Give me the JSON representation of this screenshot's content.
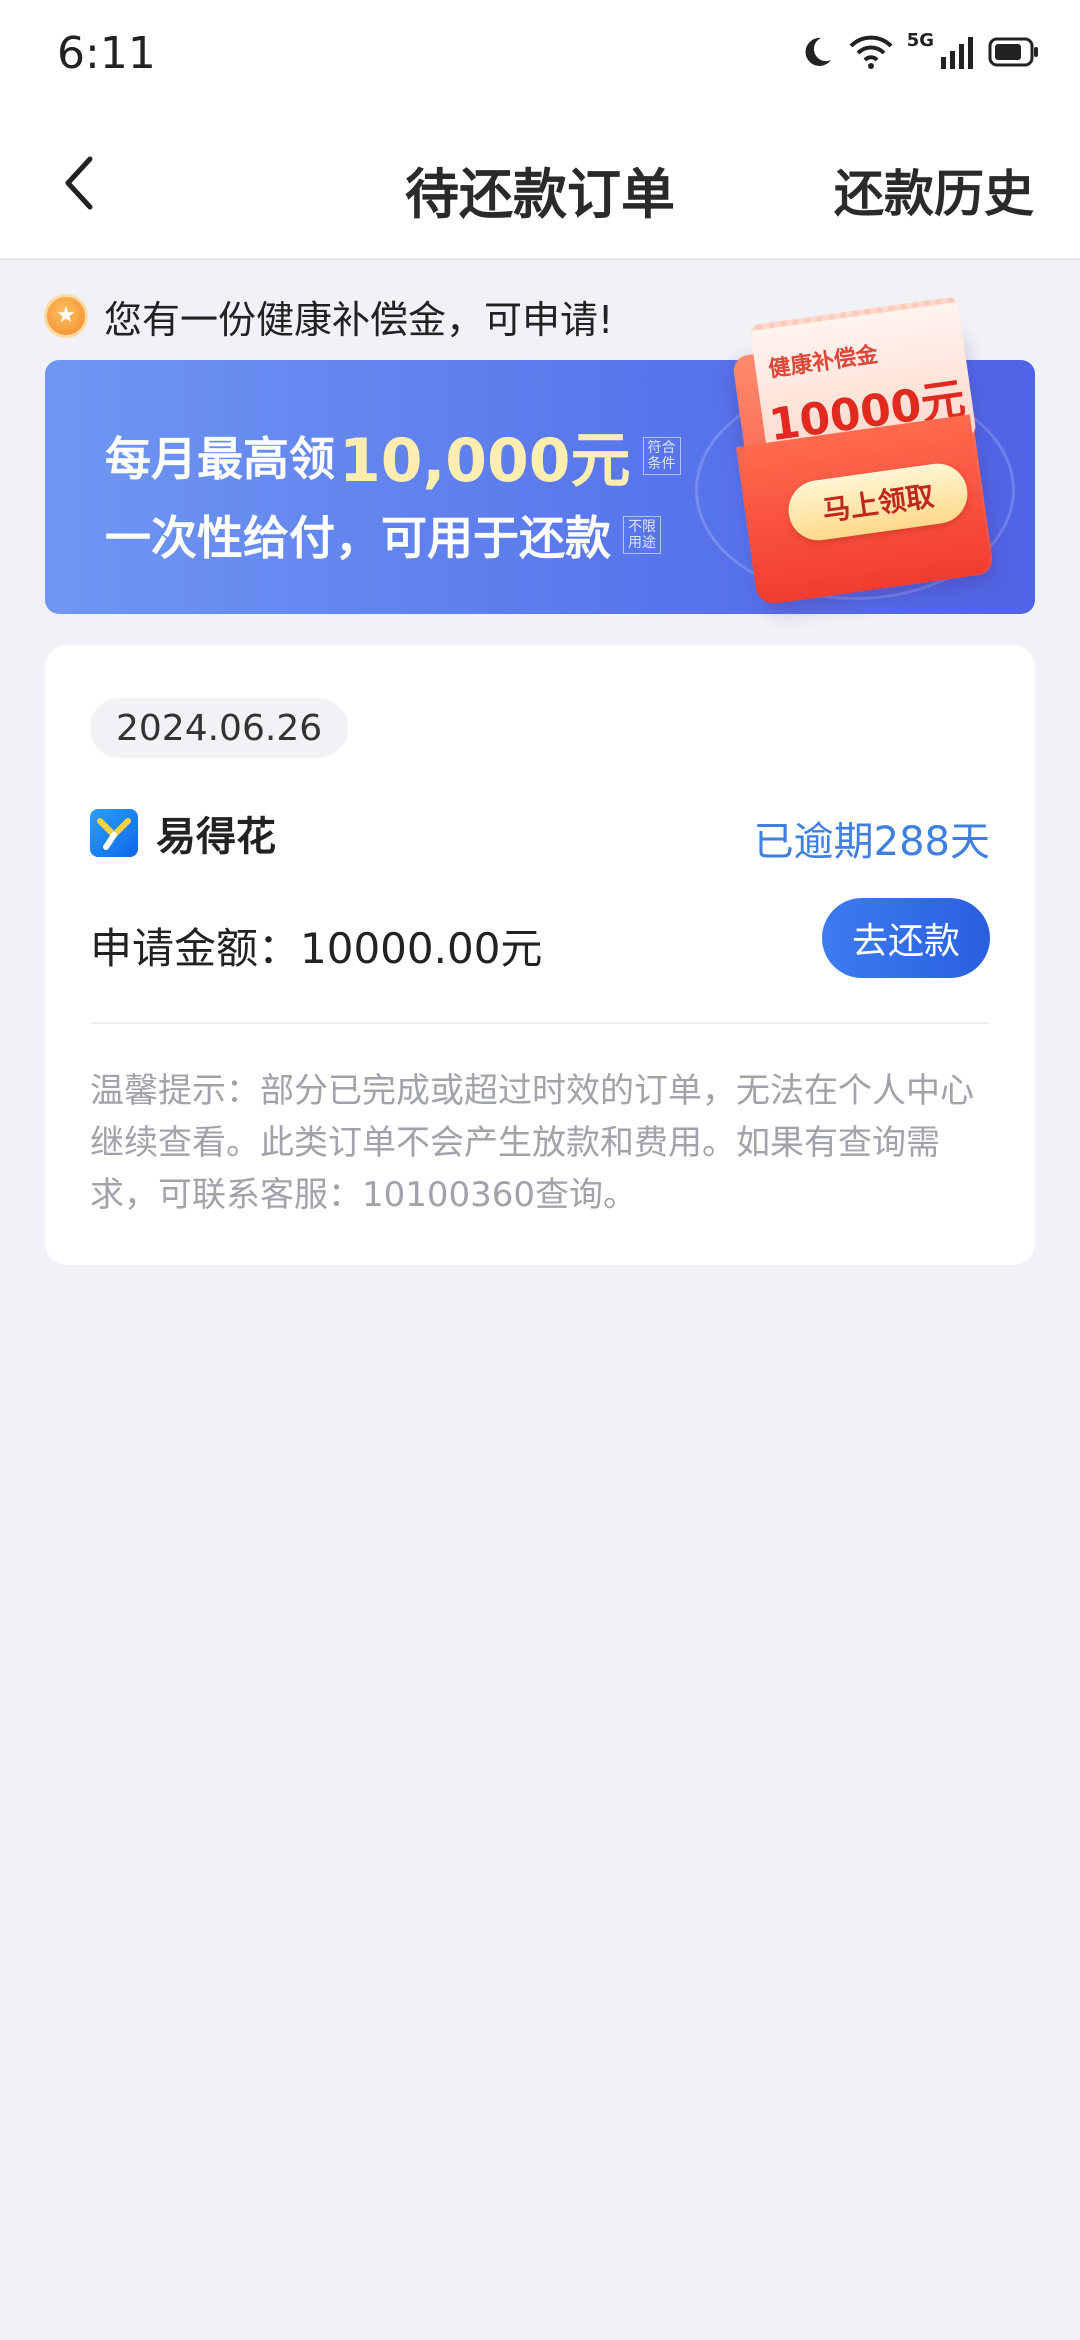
{
  "status_bar": {
    "time": "6:11",
    "network": "5G",
    "icons": [
      "moon-icon",
      "wifi-icon",
      "signal-icon",
      "battery-icon"
    ]
  },
  "nav": {
    "title": "待还款订单",
    "right_link": "还款历史",
    "back_icon": "chevron-left-icon"
  },
  "notice": {
    "icon": "medal-icon",
    "text": "您有一份健康补偿金，可申请!"
  },
  "banner": {
    "line1_prefix": "每月最高领",
    "line1_amount": "10,000元",
    "line1_tag": "符合条件",
    "line2": "一次性给付，可用于还款",
    "line2_tag": "不限用途",
    "packet_title": "健康补偿金",
    "packet_amount": "10000元",
    "packet_button": "马上领取"
  },
  "order": {
    "date": "2024.06.26",
    "brand_icon": "yidehua-logo-icon",
    "brand_name": "易得花",
    "overdue_status": "已逾期288天",
    "amount_label": "申请金额：",
    "amount_value": "10000.00元",
    "repay_button": "去还款",
    "tip": "温馨提示：部分已完成或超过时效的订单，无法在个人中心继续查看。此类订单不会产生放款和费用。如果有查询需求，可联系客服：10100360查询。"
  },
  "colors": {
    "accent_blue": "#3f7fe0",
    "banner_start": "#6f97f2",
    "banner_end": "#4f63e6",
    "page_bg": "#f0f2f7"
  }
}
